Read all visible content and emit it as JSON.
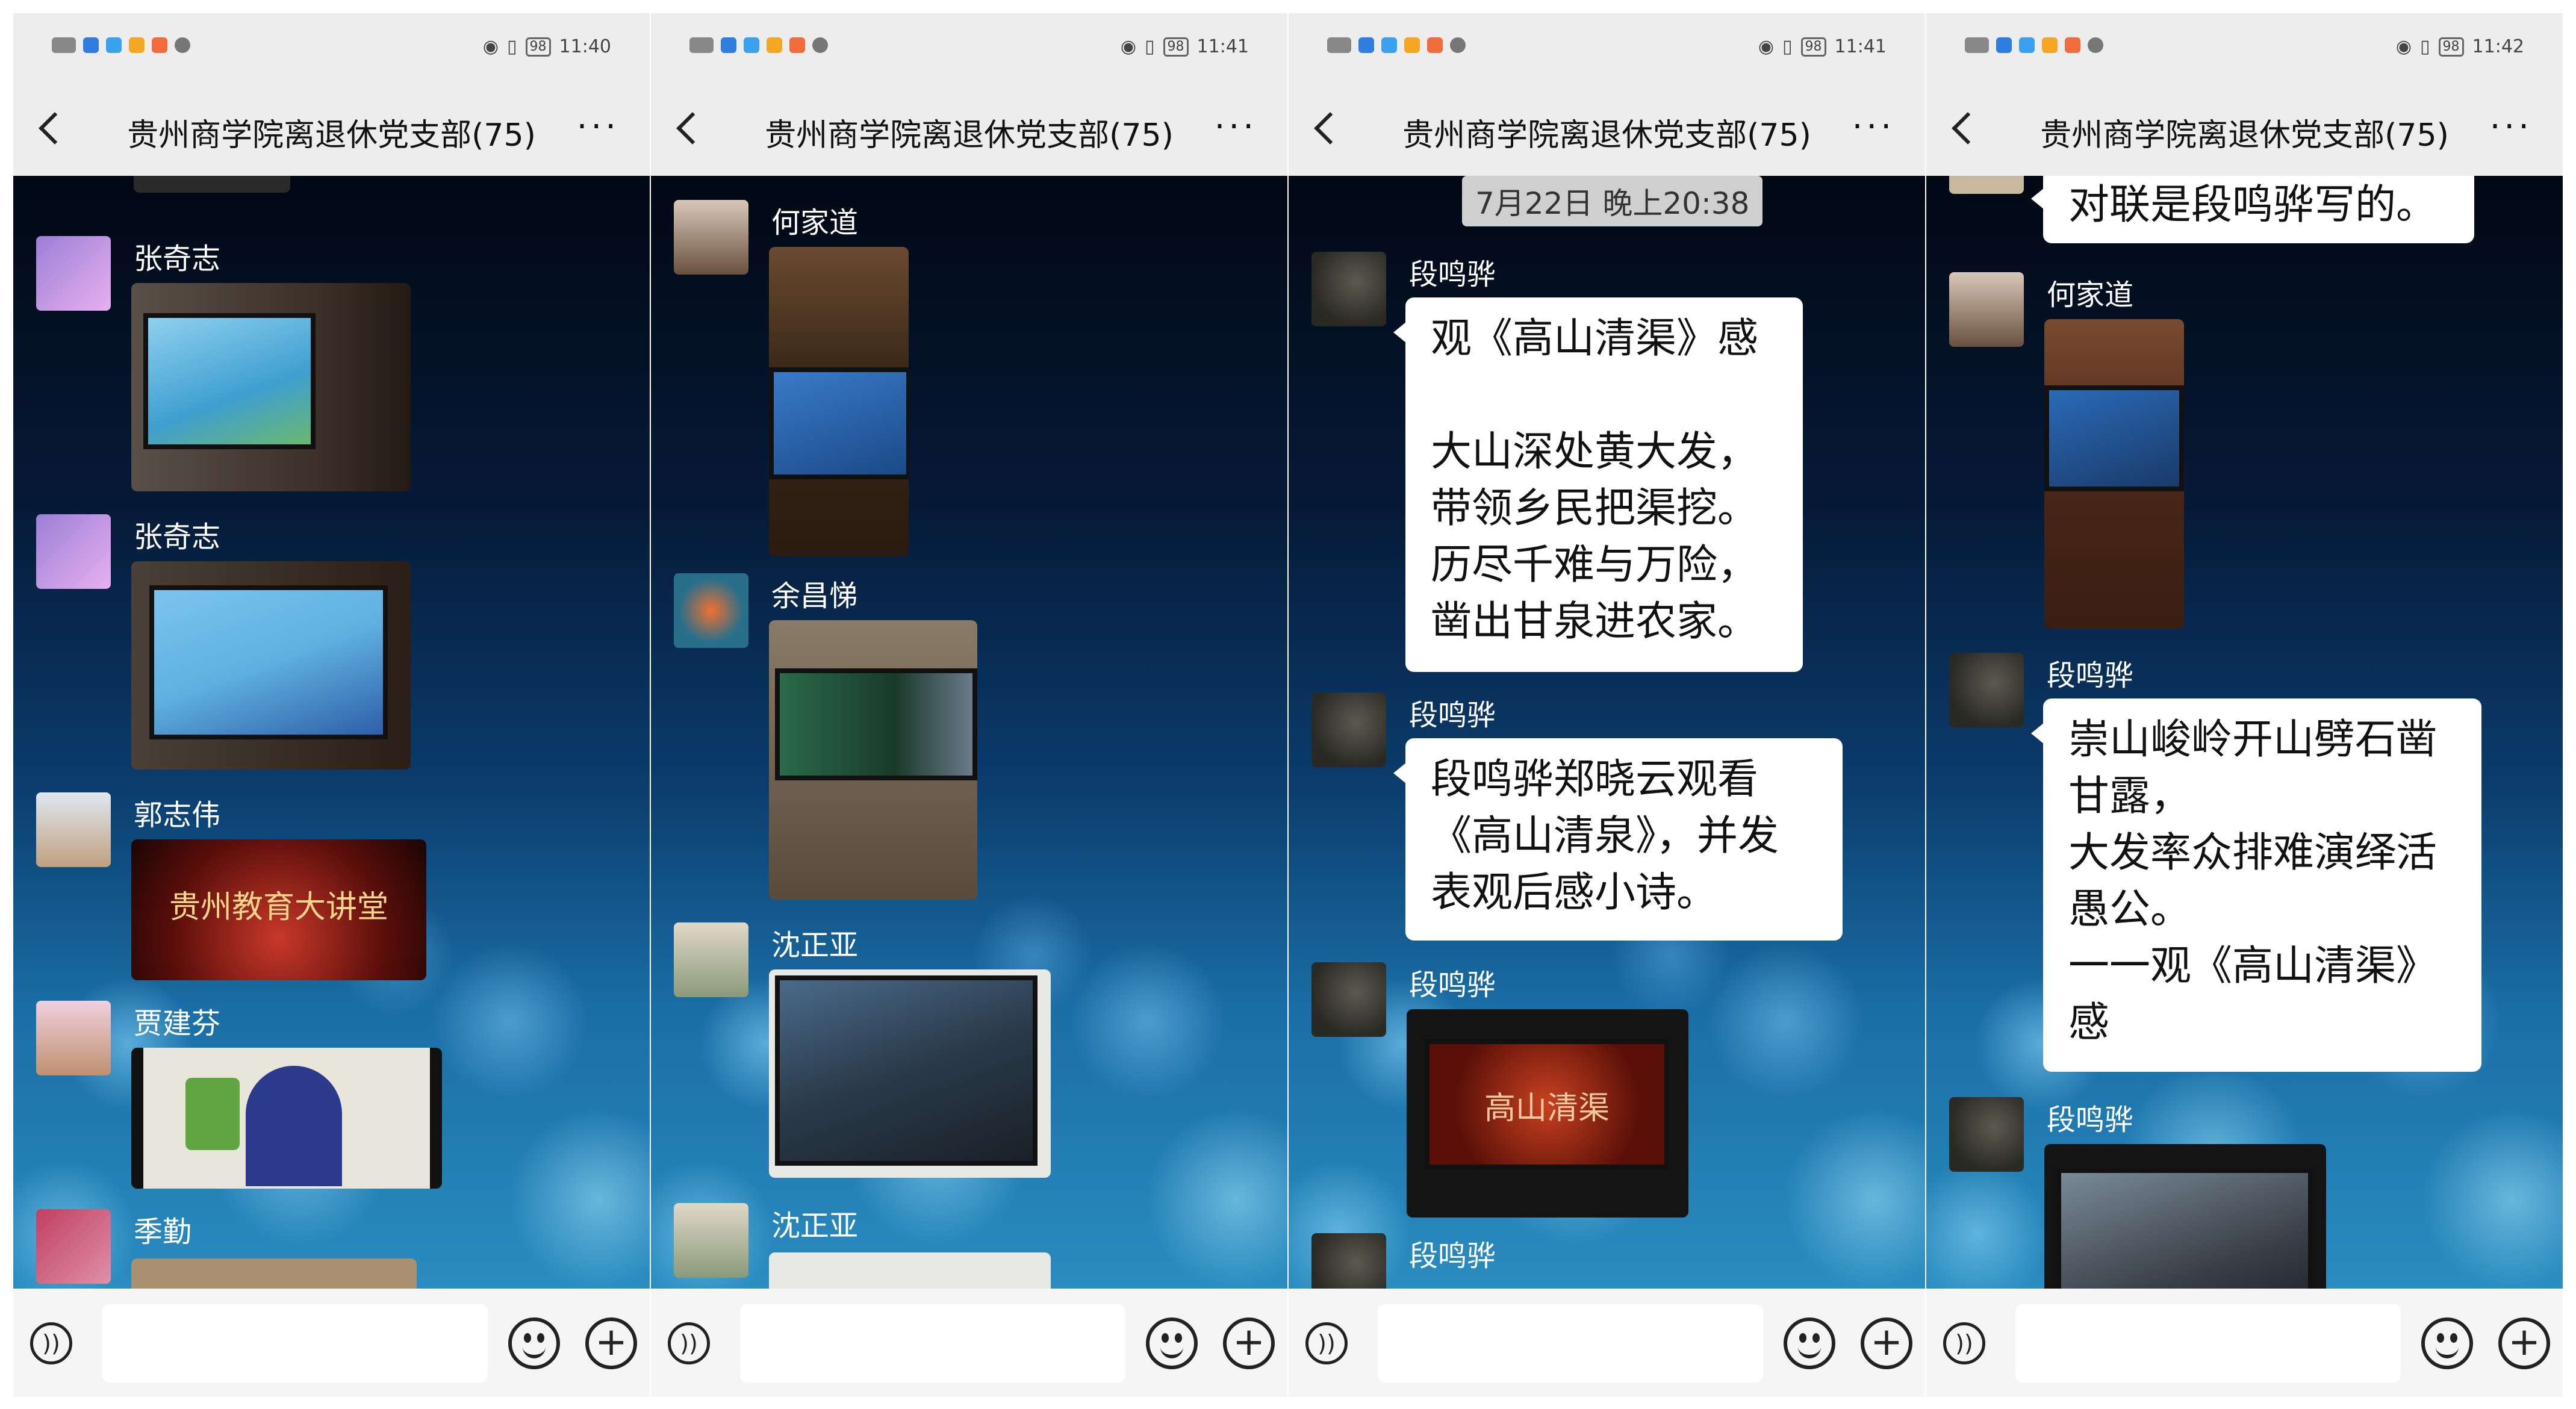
{
  "screens": [
    {
      "status": {
        "time": "11:40",
        "battery": "98"
      },
      "title": "贵州商学院离退休党支部(75)",
      "messages": [
        {
          "sender": "张奇志"
        },
        {
          "sender": "张奇志"
        },
        {
          "sender": "郭志伟",
          "caption": "贵州教育大讲堂"
        },
        {
          "sender": "贾建芬"
        },
        {
          "sender": "季勤"
        }
      ]
    },
    {
      "status": {
        "time": "11:41",
        "battery": "98"
      },
      "title": "贵州商学院离退休党支部(75)",
      "messages": [
        {
          "sender": "何家道"
        },
        {
          "sender": "余昌悌"
        },
        {
          "sender": "沈正亚"
        },
        {
          "sender": "沈正亚"
        }
      ]
    },
    {
      "status": {
        "time": "11:41",
        "battery": "98"
      },
      "title": "贵州商学院离退休党支部(75)",
      "timestamp": "7月22日 晚上20:38",
      "messages": [
        {
          "sender": "段鸣骅",
          "lines": [
            "观《高山清渠》感",
            "",
            "大山深处黄大发，",
            "带领乡民把渠挖。",
            "历尽千难与万险，",
            "凿出甘泉进农家。"
          ]
        },
        {
          "sender": "段鸣骅",
          "lines": [
            "段鸣骅郑晓云观看",
            "《高山清泉》，并发",
            "表观后感小诗。"
          ]
        },
        {
          "sender": "段鸣骅",
          "caption": "高山清渠"
        },
        {
          "sender": "段鸣骅"
        }
      ]
    },
    {
      "status": {
        "time": "11:42",
        "battery": "98"
      },
      "title": "贵州商学院离退休党支部(75)",
      "messages": [
        {
          "lines": [
            "对联是段鸣骅写的。"
          ]
        },
        {
          "sender": "何家道"
        },
        {
          "sender": "段鸣骅",
          "lines": [
            "崇山峻岭开山劈石凿",
            "甘露，",
            "大发率众排难演绎活",
            "愚公。",
            "一一观《高山清渠》",
            "感"
          ]
        },
        {
          "sender": "段鸣骅"
        }
      ]
    }
  ],
  "colors": {
    "chat_top": "#020814",
    "chat_bottom": "#2a8cc0",
    "bar": "#ededed",
    "bubble": "#ffffff"
  }
}
